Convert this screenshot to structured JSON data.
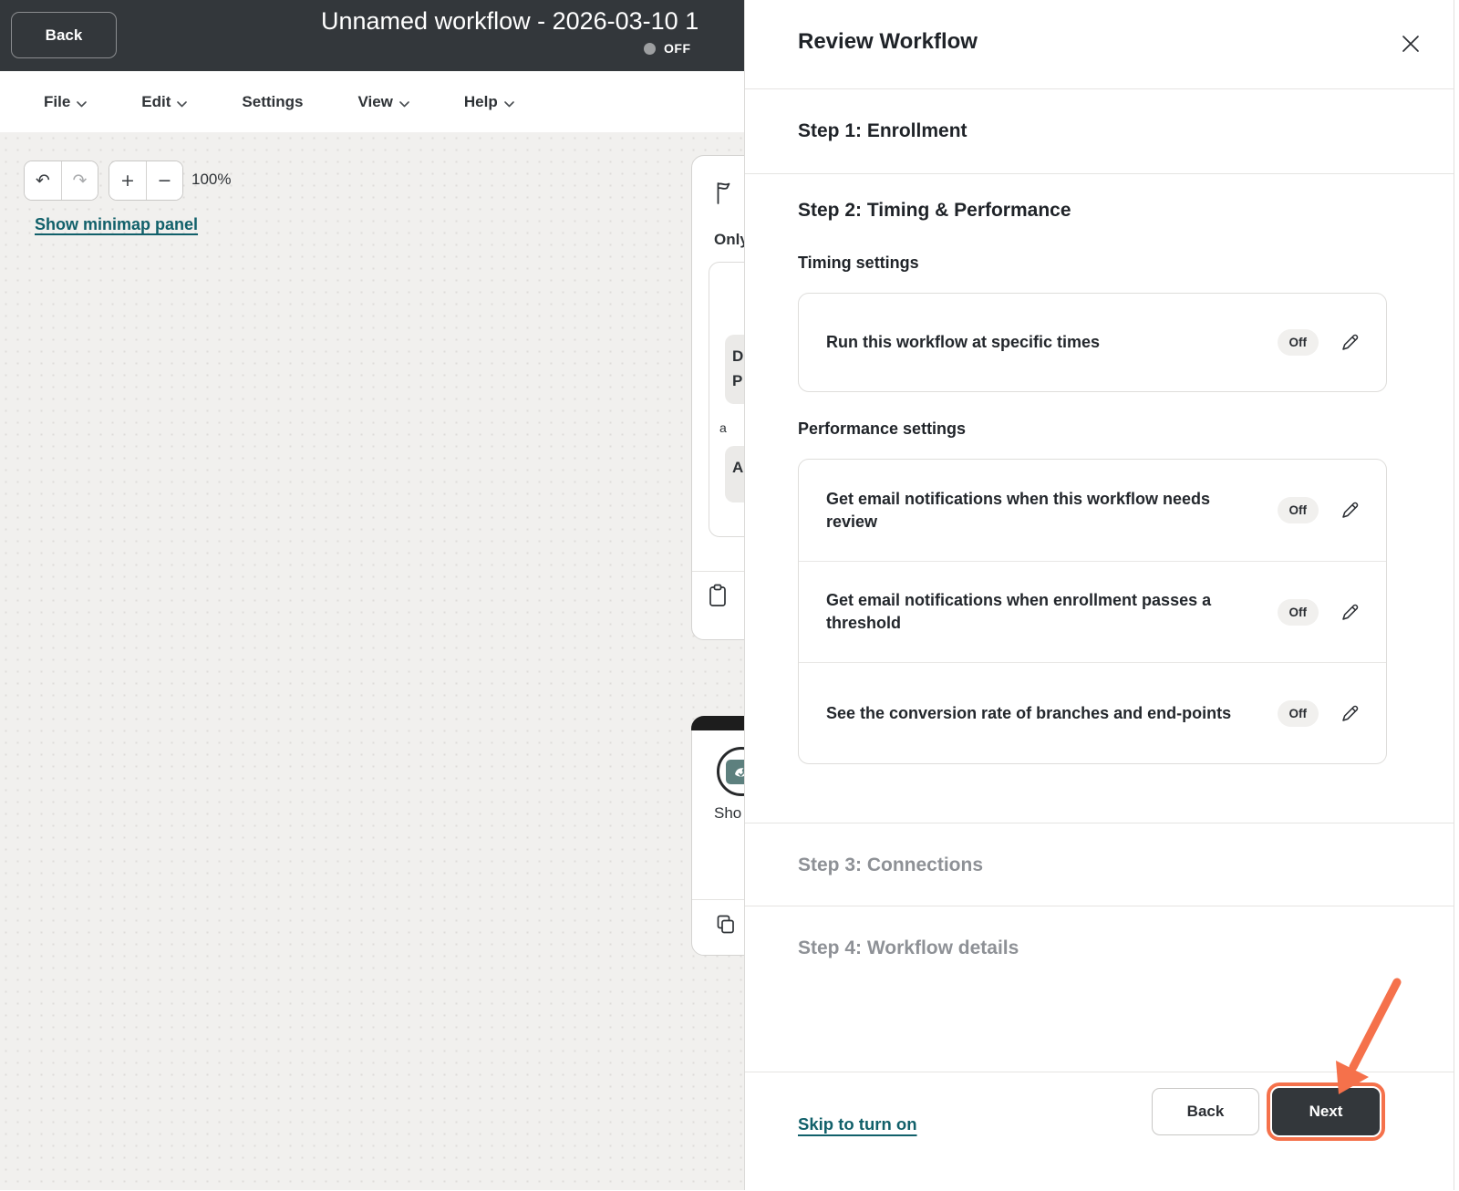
{
  "top_bar": {
    "back_label": "Back",
    "title": "Unnamed workflow - 2026-03-10 1",
    "status_toggle_label": "OFF"
  },
  "menu_bar": {
    "items": [
      {
        "label": "File",
        "has_chevron": true
      },
      {
        "label": "Edit",
        "has_chevron": true
      },
      {
        "label": "Settings",
        "has_chevron": false
      },
      {
        "label": "View",
        "has_chevron": true
      },
      {
        "label": "Help",
        "has_chevron": true
      }
    ]
  },
  "canvas": {
    "zoom_level": "100%",
    "minimap_link_label": "Show minimap panel",
    "trigger_card": {
      "title_partial": "Only",
      "pill1_text": "D\nP",
      "connector_partial": "a",
      "pill2_text": "A"
    },
    "action_card": {
      "title_partial": "Sho"
    }
  },
  "review_panel": {
    "title": "Review Workflow",
    "step1_label": "Step 1: Enrollment",
    "step2_label": "Step 2: Timing & Performance",
    "step3_label": "Step 3: Connections",
    "step4_label": "Step 4: Workflow details",
    "timing_heading": "Timing settings",
    "performance_heading": "Performance settings",
    "timing_rows": [
      {
        "label": "Run this workflow at specific times",
        "status": "Off"
      }
    ],
    "performance_rows": [
      {
        "label": "Get email notifications when this workflow needs review",
        "status": "Off"
      },
      {
        "label": "Get email notifications when enrollment passes a threshold",
        "status": "Off"
      },
      {
        "label": "See the conversion rate of branches and end-points",
        "status": "Off"
      }
    ],
    "footer": {
      "skip_label": "Skip to turn on",
      "back_label": "Back",
      "next_label": "Next"
    }
  },
  "colors": {
    "header_bg": "#33373b",
    "accent_orange": "#f5714b",
    "link_teal": "#11606a",
    "muted_step_gray": "#8e9196"
  }
}
